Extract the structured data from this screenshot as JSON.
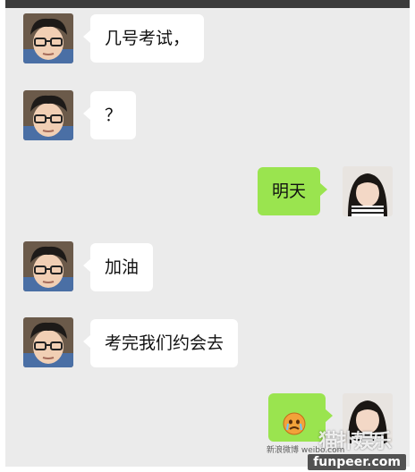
{
  "chat": {
    "messages": [
      {
        "side": "in",
        "text": "几号考试，"
      },
      {
        "side": "in",
        "text": "？"
      },
      {
        "side": "out",
        "text": "明天"
      },
      {
        "side": "in",
        "text": "加油"
      },
      {
        "side": "in",
        "text": "考完我们约会去"
      },
      {
        "side": "out",
        "text": "",
        "sticker": "crying-emoji-icon"
      }
    ]
  },
  "watermark": {
    "site": "funpeer.com",
    "logo_text": "猫扑娱乐",
    "weibo_text": "新浪微博 weibo.com"
  },
  "colors": {
    "background": "#ebebeb",
    "incoming_bubble": "#ffffff",
    "outgoing_bubble": "#9ae44f",
    "header_bar": "#3b3b3b"
  }
}
